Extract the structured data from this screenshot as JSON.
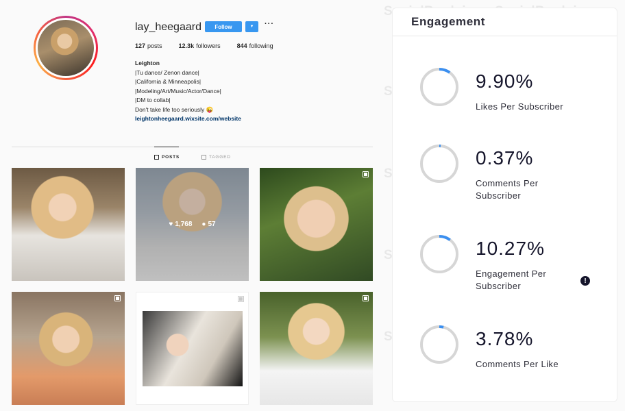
{
  "profile": {
    "username": "lay_heegaard",
    "follow_label": "Follow",
    "dropdown_icon": "chevron-down-icon",
    "more_label": "···",
    "stats": {
      "posts_count": "127",
      "posts_label": "posts",
      "followers_count": "12.3k",
      "followers_label": "followers",
      "following_count": "844",
      "following_label": "following"
    },
    "bio": {
      "name": "Leighton",
      "lines": [
        "|Tu dance/ Zenon dance|",
        "|California & Minneapolis|",
        "|Modeling/Art/Music/Actor/Dance|",
        "|DM to collab|",
        "Don't take life too seriously 😜"
      ],
      "link": "leightonheegaard.wixsite.com/website"
    },
    "tabs": {
      "posts": "POSTS",
      "tagged": "TAGGED"
    },
    "hover_post": {
      "likes": "1,768",
      "comments": "57"
    }
  },
  "engagement": {
    "title": "Engagement",
    "metrics": [
      {
        "value": "9.90%",
        "label": "Likes Per Subscriber",
        "fraction": 0.099
      },
      {
        "value": "0.37%",
        "label": "Comments Per Subscriber",
        "fraction": 0.0037
      },
      {
        "value": "10.27%",
        "label": "Engagement Per Subscriber",
        "fraction": 0.1027
      },
      {
        "value": "3.78%",
        "label": "Comments Per Like",
        "fraction": 0.0378
      }
    ]
  },
  "watermark": "SocialBook.io",
  "colors": {
    "accent": "#3897f0",
    "ring_track": "#d6d6d6",
    "ring_fill": "#3b8ff0",
    "link": "#003569"
  }
}
